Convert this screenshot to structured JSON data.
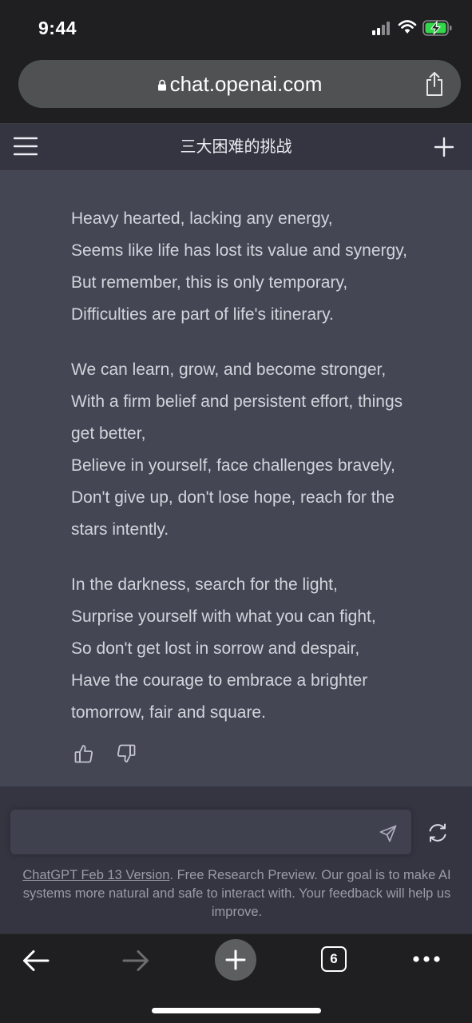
{
  "status_bar": {
    "time": "9:44",
    "icons": [
      "signal-icon",
      "wifi-icon",
      "battery-charging-icon"
    ]
  },
  "browser": {
    "url": "chat.openai.com",
    "icons": [
      "lock-icon",
      "share-icon"
    ]
  },
  "chat": {
    "title": "三大困难的挑战",
    "icons": [
      "menu-icon",
      "new-chat-plus-icon"
    ]
  },
  "message": {
    "stanzas": [
      {
        "lines": [
          "Heavy hearted, lacking any energy,",
          "Seems like life has lost its value and synergy,",
          "But remember, this is only temporary,",
          "Difficulties are part of life's itinerary."
        ]
      },
      {
        "lines": [
          "We can learn, grow, and become stronger,",
          "With a firm belief and persistent effort, things",
          "get better,",
          "Believe in yourself, face challenges bravely,",
          "Don't give up, don't lose hope, reach for the",
          "stars intently."
        ]
      },
      {
        "lines": [
          "In the darkness, search for the light,",
          "Surprise yourself with what you can fight,",
          "So don't get lost in sorrow and despair,",
          "Have the courage to embrace a brighter",
          "tomorrow, fair and square."
        ]
      }
    ],
    "feedback_icons": [
      "thumbs-up-icon",
      "thumbs-down-icon"
    ]
  },
  "composer": {
    "input_value": "",
    "icons": [
      "send-icon",
      "regenerate-icon"
    ]
  },
  "footer": {
    "link_text": "ChatGPT Feb 13 Version",
    "text": ". Free Research Preview. Our goal is to make AI systems more natural and safe to interact with. Your feedback will help us improve."
  },
  "toolbar": {
    "tab_count": "6",
    "icons": [
      "back-arrow-icon",
      "forward-arrow-icon",
      "new-tab-plus-icon",
      "tabs-icon",
      "more-icon"
    ]
  },
  "colors": {
    "message_bg": "#444654",
    "page_bg": "#343541",
    "text": "#d1d5db",
    "chrome_bg": "#1f1f21"
  }
}
